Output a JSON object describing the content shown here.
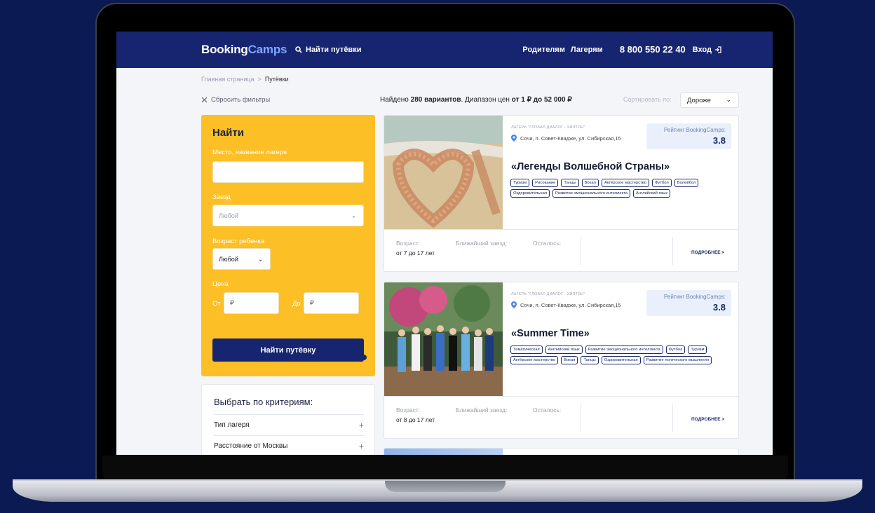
{
  "header": {
    "logo_main": "Booking",
    "logo_accent": "Camps",
    "find_link": "Найти путёвки",
    "nav": [
      "Родителям",
      "Лагерям"
    ],
    "phone": "8 800 550 22 40",
    "login": "Вход"
  },
  "breadcrumb": {
    "home": "Главная страница",
    "sep": ">",
    "current": "Путёвки"
  },
  "toolbar": {
    "reset": "Сбросить фильтры",
    "found_prefix": "Найдено ",
    "found_count": "280 вариантов",
    "found_mid": ". Диапазон цен ",
    "found_range": "от 1 ₽ до 52 000 ₽",
    "sort_label": "Сортировать по:",
    "sort_value": "Дороже"
  },
  "filter": {
    "title": "Найти",
    "place_label": "Место, название лагеря",
    "place_value": "",
    "checkin_label": "Заезд",
    "checkin_value": "Любой",
    "age_label": "Возраст ребенка",
    "age_value": "Любой",
    "price_label": "Цена",
    "from_label": "От",
    "to_label": "До",
    "currency": "₽",
    "button": "Найти путёвку"
  },
  "criteria": {
    "title": "Выбрать по критериям:",
    "rows": [
      "Тип лагеря",
      "Расстояние от Москвы"
    ]
  },
  "cards": [
    {
      "camp": "Лагерь \"Глобал Диалог - Хилтон\"",
      "address": "Сочи, п. Совет-Квадже, ул. Сибирская,15",
      "rating_label": "Рейтинг BookingCamps:",
      "rating": "3.8",
      "title": "«Легенды Волшебной Страны»",
      "tags": [
        "Туризм",
        "Рисование",
        "Танцы",
        "Вокал",
        "Актёрское мастерство",
        "Футбол",
        "Волейбол",
        "Оздоровительная",
        "Развитие эмоционального интеллекта",
        "Английский язык"
      ],
      "age_label": "Возраст:",
      "age_value": "от 7 до 17 лет",
      "next_label": "Ближайший заезд:",
      "left_label": "Осталось:",
      "more": "подробнее >"
    },
    {
      "camp": "Лагерь \"Глобал Диалог - Хилтон\"",
      "address": "Сочи, п. Совет-Квадже, ул. Сибирская,15",
      "rating_label": "Рейтинг BookingCamps:",
      "rating": "3.8",
      "title": "«Summer Time»",
      "tags": [
        "Тематическая",
        "Английский язык",
        "Развитие эмоционального интеллекта",
        "Футбол",
        "Туризм",
        "Актёрское мастерство",
        "Вокал",
        "Танцы",
        "Оздоровительная",
        "Развитие логического мышления"
      ],
      "age_label": "Возраст:",
      "age_value": "от 8 до 17 лет",
      "next_label": "Ближайший заезд:",
      "left_label": "Осталось:",
      "more": "подробнее >"
    }
  ],
  "colors": {
    "navy": "#172570",
    "yellow": "#fdbf26",
    "accent": "#7fa8ff"
  }
}
